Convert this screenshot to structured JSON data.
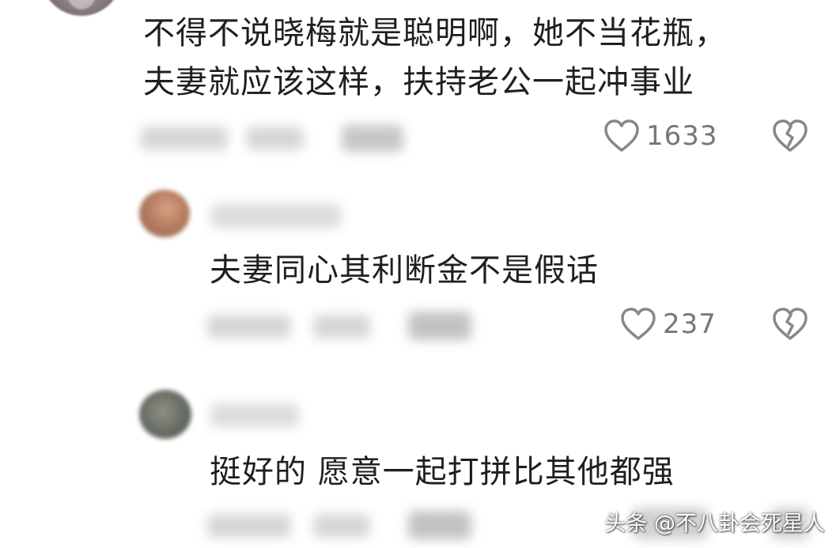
{
  "comments": [
    {
      "lines": [
        "不得不说晓梅就是聪明啊，她不当花瓶，",
        "夫妻就应该这样，扶持老公一起冲事业"
      ],
      "likes": "1633"
    },
    {
      "lines": [
        "夫妻同心其利断金不是假话"
      ],
      "likes": "237"
    },
    {
      "lines": [
        "挺好的 愿意一起打拼比其他都强"
      ],
      "likes": ""
    }
  ],
  "icons": {
    "like": "heart-outline-icon",
    "dislike": "broken-heart-icon"
  },
  "colors": {
    "text": "#1f1f1f",
    "meta": "#777777",
    "background": "#ffffff"
  },
  "watermark": "头条 @不八卦会死星人"
}
